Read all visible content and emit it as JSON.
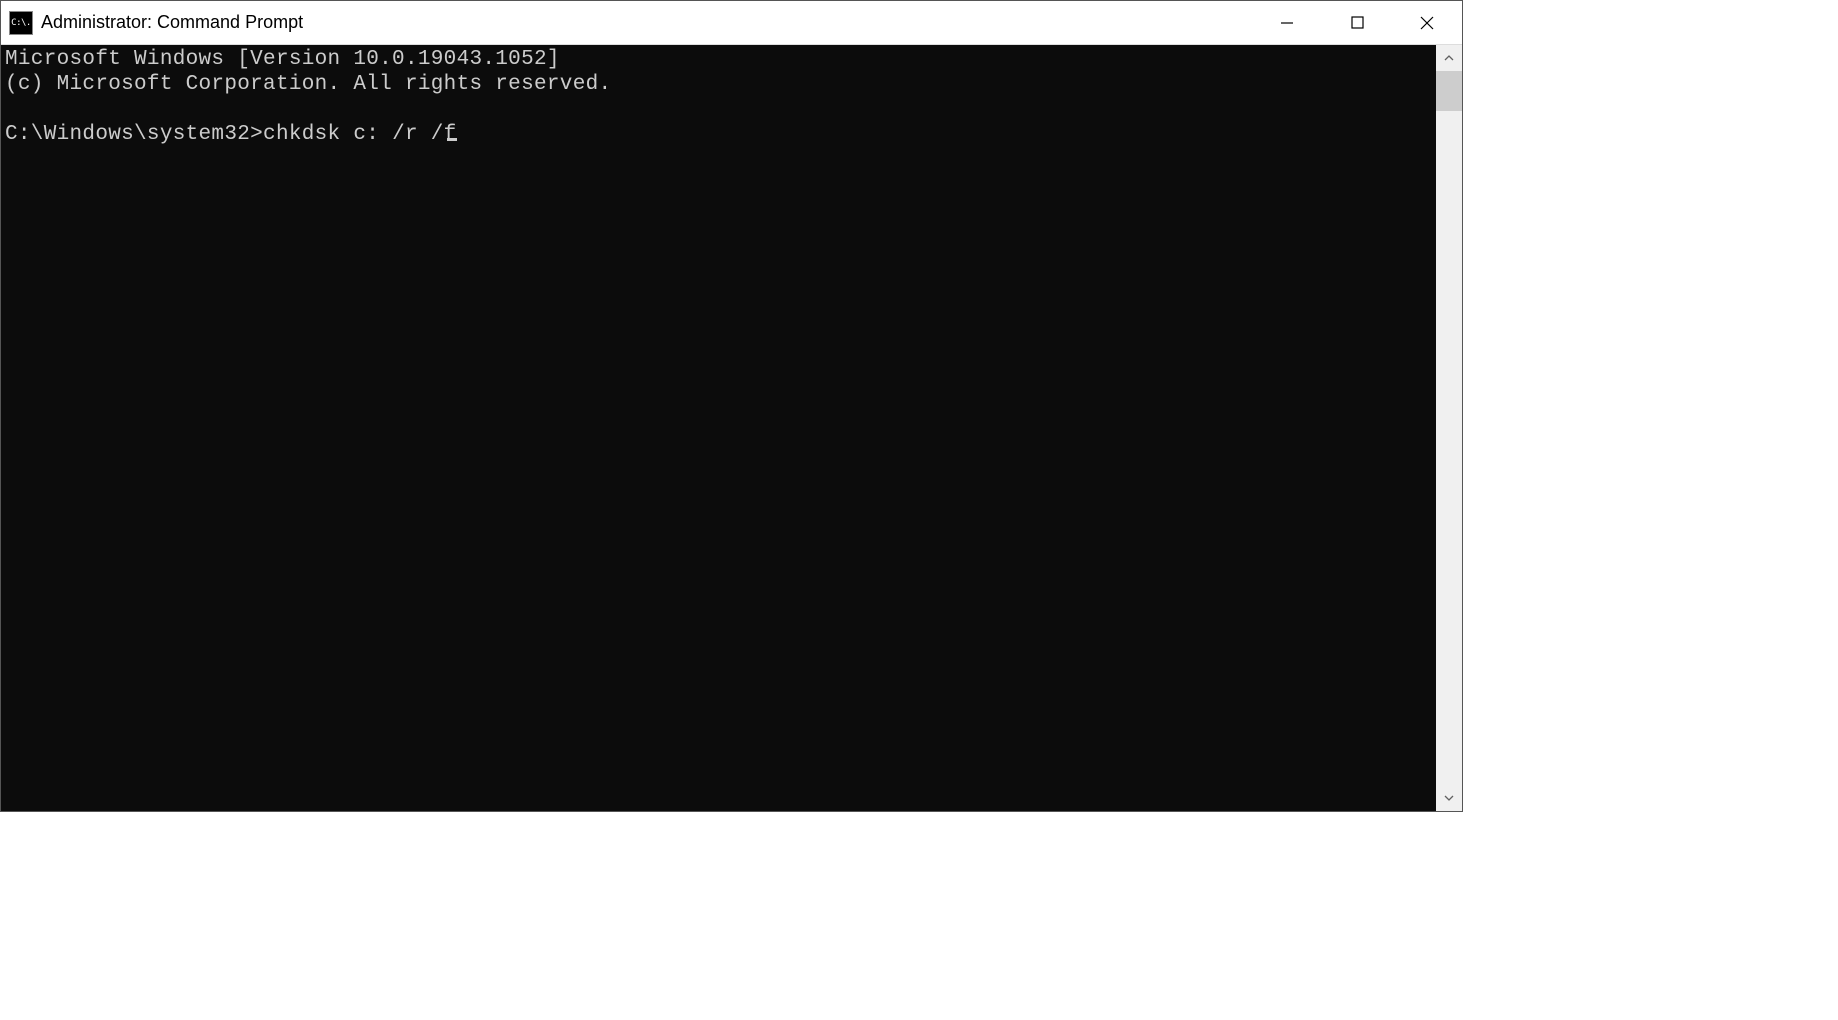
{
  "window": {
    "title": "Administrator: Command Prompt",
    "icon_label": "C:\\."
  },
  "terminal": {
    "line1": "Microsoft Windows [Version 10.0.19043.1052]",
    "line2": "(c) Microsoft Corporation. All rights reserved.",
    "blank": "",
    "prompt": "C:\\Windows\\system32>",
    "command": "chkdsk c: /r /f"
  }
}
